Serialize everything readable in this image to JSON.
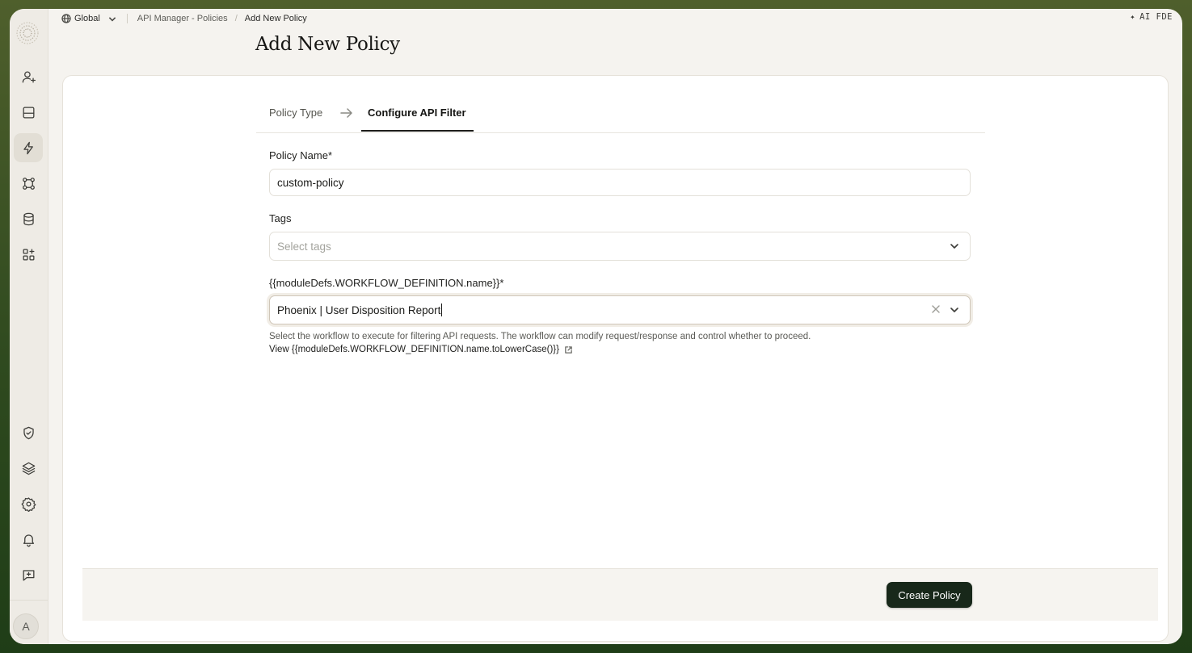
{
  "topbar": {
    "workspace": "Global",
    "breadcrumb": [
      "API Manager - Policies",
      "Add New Policy"
    ],
    "ai_label": "AI FDE"
  },
  "page": {
    "title": "Add New Policy"
  },
  "tabs": {
    "step1": "Policy Type",
    "step2": "Configure API Filter",
    "active": "Configure API Filter"
  },
  "form": {
    "policy_name_label": "Policy Name*",
    "policy_name_value": "custom-policy",
    "tags_label": "Tags",
    "tags_placeholder": "Select tags",
    "workflow_label": "{{moduleDefs.WORKFLOW_DEFINITION.name}}*",
    "workflow_value": "Phoenix | User Disposition Report",
    "workflow_help": "Select the workflow to execute for filtering API requests. The workflow can modify request/response and control whether to proceed.",
    "view_link": "View {{moduleDefs.WORKFLOW_DEFINITION.name.toLowerCase()}}"
  },
  "footer": {
    "create_label": "Create Policy"
  },
  "sidebar": {
    "avatar_initial": "A",
    "icons": [
      "user-plus-icon",
      "inbox-icon",
      "lightning-icon",
      "workflow-nodes-icon",
      "database-icon",
      "apps-add-icon",
      "shield-check-icon",
      "layers-icon",
      "gear-icon",
      "bell-icon",
      "feedback-icon"
    ],
    "active": "lightning-icon"
  },
  "colors": {
    "accent": "#18281a",
    "background": "#f5f3ef",
    "frame": "#3b5425"
  }
}
